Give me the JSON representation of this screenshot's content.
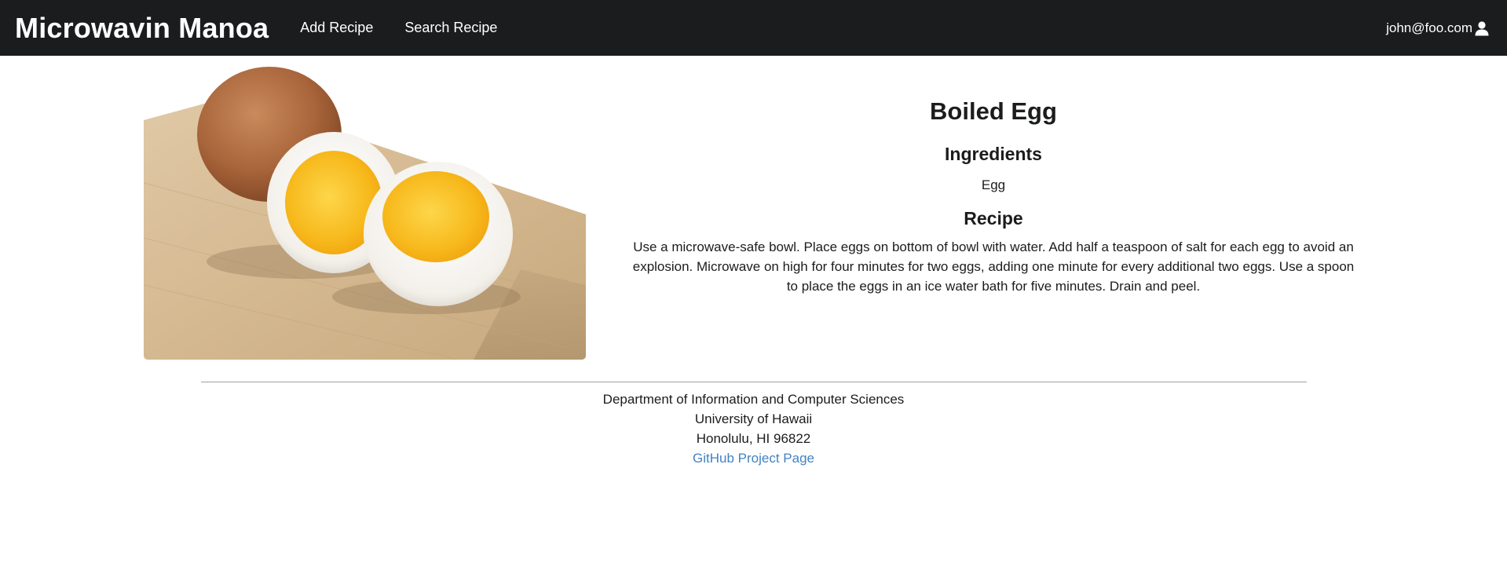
{
  "navbar": {
    "brand": "Microwavin Manoa",
    "links": [
      "Add Recipe",
      "Search Recipe"
    ],
    "user_email": "john@foo.com"
  },
  "recipe": {
    "title": "Boiled Egg",
    "ingredients_heading": "Ingredients",
    "ingredients": "Egg",
    "recipe_heading": "Recipe",
    "instructions": "Use a microwave-safe bowl. Place eggs on bottom of bowl with water. Add half a teaspoon of salt for each egg to avoid an explosion. Microwave on high for four minutes for two eggs, adding one minute for every additional two eggs. Use a spoon to place the eggs in an ice water bath for five minutes. Drain and peel."
  },
  "footer": {
    "lines": [
      "Department of Information and Computer Sciences",
      "University of Hawaii",
      "Honolulu, HI 96822"
    ],
    "link_text": "GitHub Project Page"
  },
  "colors": {
    "navbar_bg": "#1b1c1d",
    "link": "#4183c4"
  },
  "icons": {
    "user": "user-icon"
  }
}
